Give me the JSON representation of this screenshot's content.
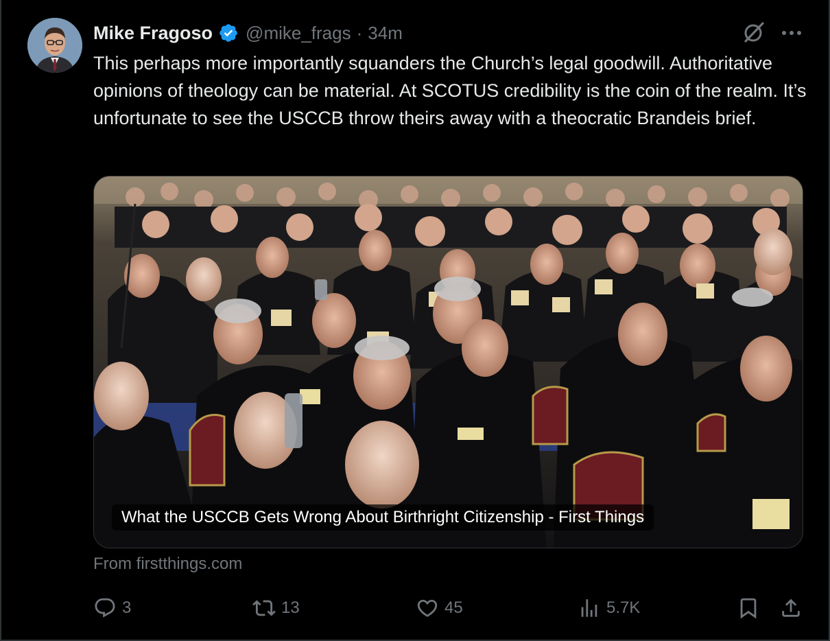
{
  "author": {
    "display_name": "Mike Fragoso",
    "handle": "@mike_frags",
    "separator": "·",
    "time": "34m",
    "verified": true
  },
  "tweet": {
    "text": "This perhaps more importantly squanders the Church’s legal goodwill. Authoritative opinions of theology can be material. At SCOTUS credibility is the coin of the realm. It’s unfortunate to see the USCCB throw theirs away with a theocratic Brandeis brief."
  },
  "card": {
    "title": "What the USCCB Gets Wrong About Birthright Citizenship - First Things",
    "source": "From firstthings.com"
  },
  "actions": {
    "replies": "3",
    "reposts": "13",
    "likes": "45",
    "views": "5.7K"
  },
  "icons": {
    "verified": "verified-badge-icon",
    "grok": "grok-icon",
    "more": "more-icon",
    "reply": "reply-icon",
    "repost": "repost-icon",
    "like": "like-icon",
    "views": "views-icon",
    "bookmark": "bookmark-icon",
    "share": "share-icon"
  },
  "colors": {
    "background": "#000000",
    "text_primary": "#e7e9ea",
    "text_secondary": "#71767b",
    "verified_blue": "#1d9bf0"
  }
}
